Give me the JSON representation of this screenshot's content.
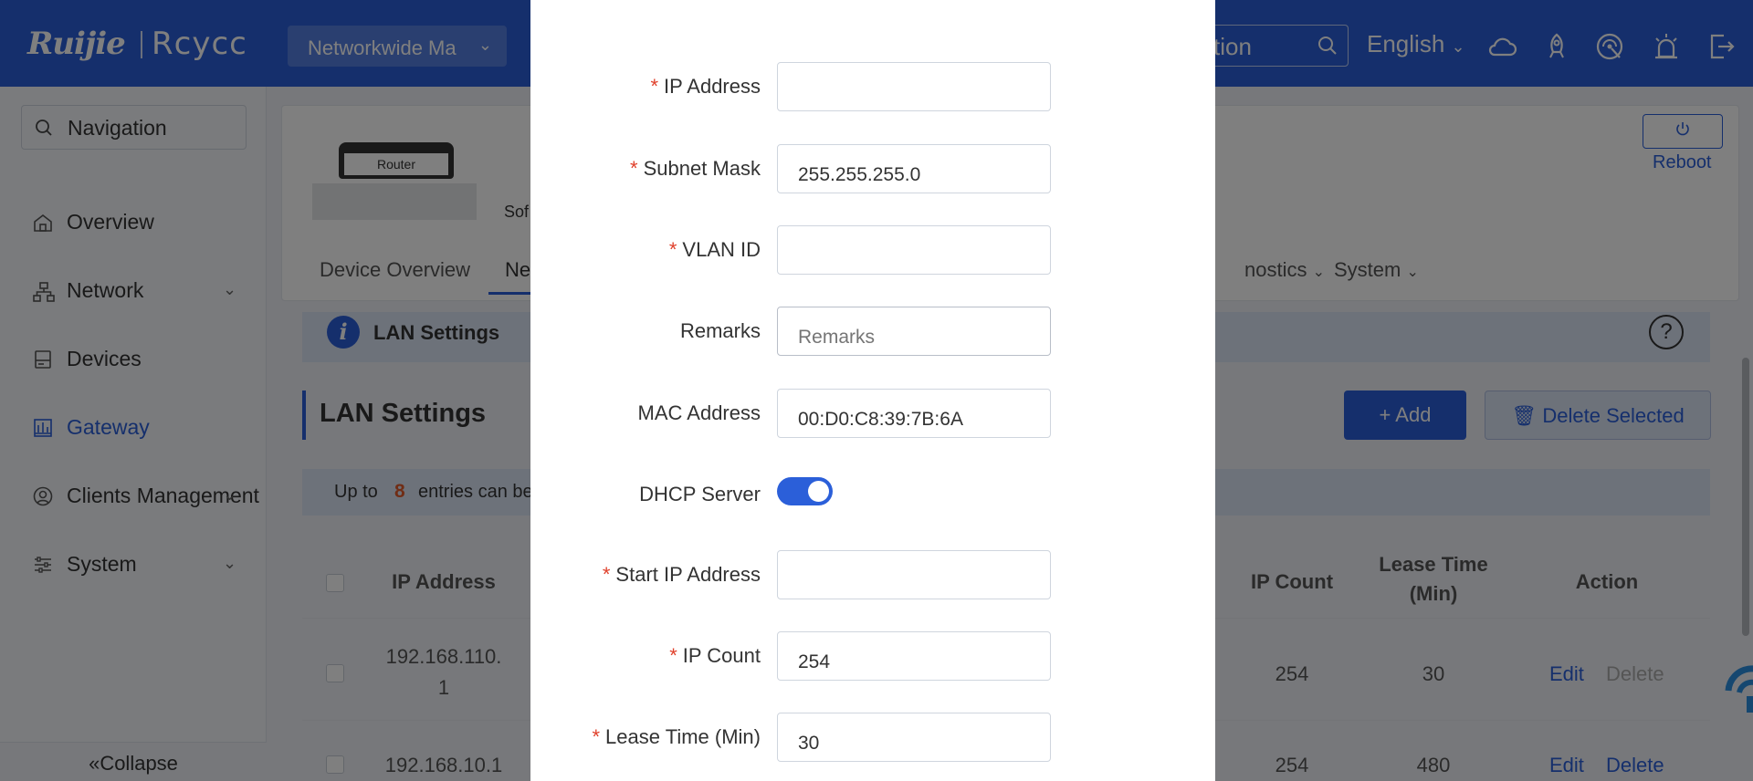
{
  "header": {
    "logo": "Ruijie",
    "logo_secondary": "Rcycc",
    "project_select": "Networkwide Ma",
    "search_text": "tion",
    "language": "English"
  },
  "sidebar": {
    "search_label": "Navigation",
    "items": [
      {
        "label": "Overview"
      },
      {
        "label": "Network"
      },
      {
        "label": "Devices"
      },
      {
        "label": "Gateway"
      },
      {
        "label": "Clients Management"
      },
      {
        "label": "System"
      }
    ],
    "collapse_label": "Collapse"
  },
  "device": {
    "router_label": "Router",
    "software_prefix": "Sof",
    "reboot_label": "Reboot"
  },
  "tabs": [
    {
      "label": "Device Overview"
    },
    {
      "label": "Ne"
    },
    {
      "label": "nostics"
    },
    {
      "label": "System"
    }
  ],
  "info_bar": {
    "title": "LAN Settings"
  },
  "section": {
    "title": "LAN Settings",
    "add_label": "+ Add",
    "delete_label": "Delete Selected"
  },
  "notice": {
    "prefix": "Up to",
    "count": "8",
    "suffix": "entries can be"
  },
  "table": {
    "headers": {
      "ip_address": "IP Address",
      "ip_count": "IP Count",
      "lease_time_1": "Lease Time",
      "lease_time_2": "(Min)",
      "action": "Action"
    },
    "rows": [
      {
        "ip_line1": "192.168.110.",
        "ip_line2": "1",
        "ip_count": "254",
        "lease": "30",
        "edit": "Edit",
        "delete": "Delete"
      },
      {
        "ip_line1": "192.168.10.1",
        "ip_count": "254",
        "lease": "480",
        "edit": "Edit",
        "delete": "Delete"
      }
    ]
  },
  "modal": {
    "fields": {
      "ip_address": {
        "label": "IP Address",
        "value": ""
      },
      "subnet_mask": {
        "label": "Subnet Mask",
        "value": "255.255.255.0"
      },
      "vlan_id": {
        "label": "VLAN ID",
        "value": ""
      },
      "remarks": {
        "label": "Remarks",
        "value": "",
        "placeholder": "Remarks"
      },
      "mac_address": {
        "label": "MAC Address",
        "value": "00:D0:C8:39:7B:6A"
      },
      "dhcp_server": {
        "label": "DHCP Server",
        "enabled": true
      },
      "start_ip": {
        "label": "Start IP Address",
        "value": ""
      },
      "ip_count": {
        "label": "IP Count",
        "value": "254"
      },
      "lease_time": {
        "label": "Lease Time (Min)",
        "value": "30"
      }
    }
  },
  "colors": {
    "brand": "#2b5fd9",
    "required": "#e0402b",
    "notice_count": "#e05a2b"
  }
}
